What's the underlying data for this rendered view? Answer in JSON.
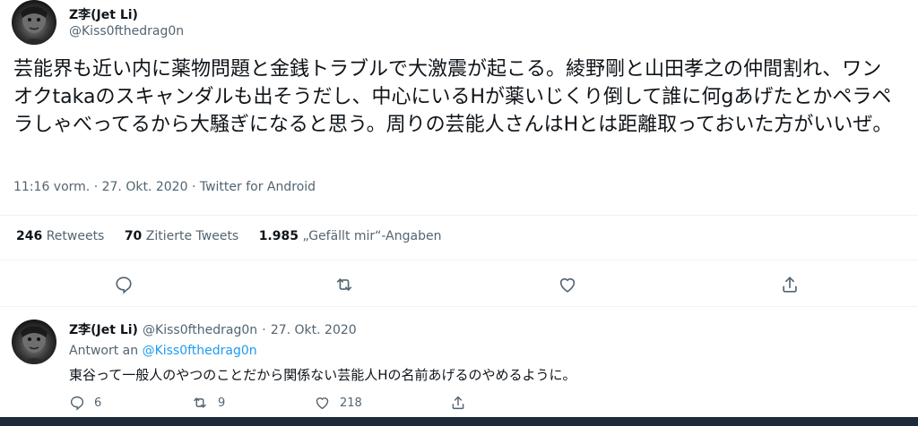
{
  "tweet": {
    "author_name": "Z李(Jet Li)",
    "author_handle": "@Kiss0fthedrag0n",
    "text": "芸能界も近い内に薬物問題と金銭トラブルで大激震が起こる。綾野剛と山田孝之の仲間割れ、ワンオクtakaのスキャンダルも出そうだし、中心にいるHが薬いじくり倒して誰に何gあげたとかペラペラしゃべってるから大騒ぎになると思う。周りの芸能人さんはHとは距離取っておいた方がいいぜ。",
    "time": "11:16 vorm.",
    "date": "27. Okt. 2020",
    "source": "Twitter for Android",
    "separator": "·"
  },
  "stats": {
    "retweets_count": "246",
    "retweets_label": "Retweets",
    "quotes_count": "70",
    "quotes_label": "Zitierte Tweets",
    "likes_count": "1.985",
    "likes_label": "„Gefällt mir“-Angaben"
  },
  "actions": {
    "reply_icon": "reply-icon",
    "retweet_icon": "retweet-icon",
    "like_icon": "heart-icon",
    "share_icon": "share-icon"
  },
  "reply": {
    "author_name": "Z李(Jet Li)",
    "author_handle": "@Kiss0fthedrag0n",
    "date": "27. Okt. 2020",
    "separator": "·",
    "reply_to_label": "Antwort an",
    "reply_to_handle": "@Kiss0fthedrag0n",
    "text": "東谷って一般人のやつのことだから関係ない芸能人Hの名前あげるのやめるように。",
    "reply_count": "6",
    "retweet_count": "9",
    "like_count": "218"
  },
  "colors": {
    "text": "#0f1419",
    "secondary": "#536471",
    "accent": "#1d9bf0",
    "bottom_bar": "#1d2a39"
  }
}
